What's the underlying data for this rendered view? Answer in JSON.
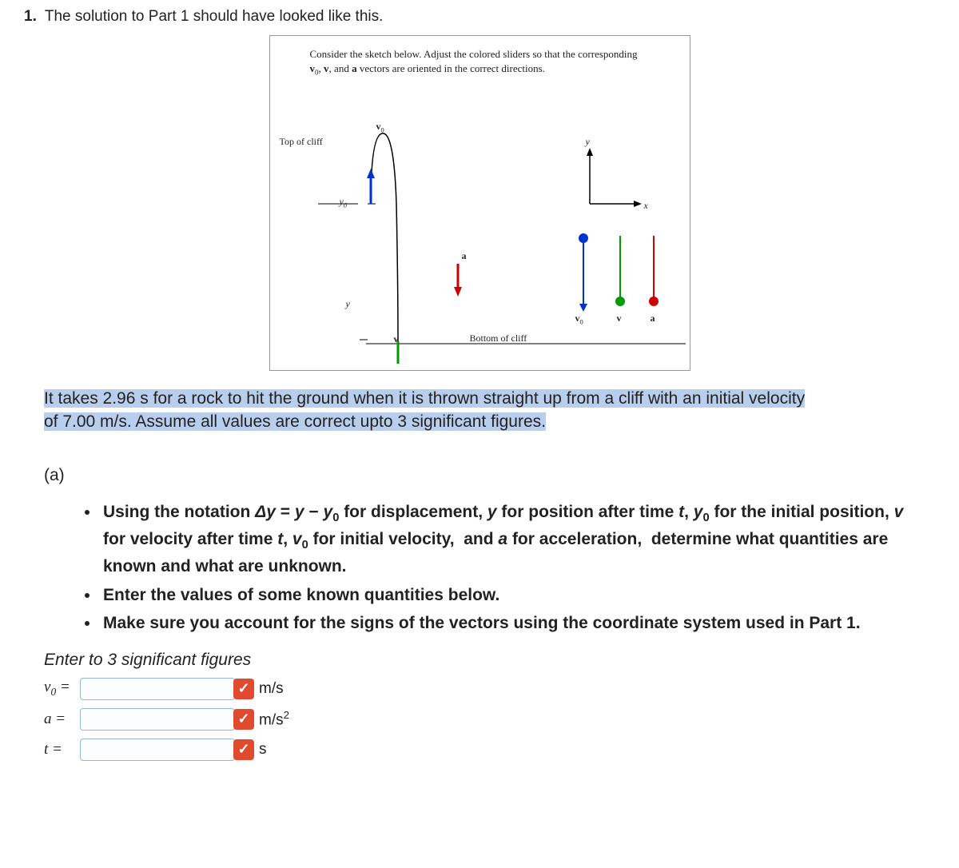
{
  "question_number": "1.",
  "intro_text": "The solution to Part 1 should have looked like this.",
  "diagram": {
    "instructions": "Consider the sketch below. Adjust the colored sliders so that the corresponding v₀, v, and a vectors are oriented in the correct directions.",
    "top_of_cliff": "Top of cliff",
    "bottom_of_cliff": "Bottom of cliff",
    "y0_label": "y₀",
    "y_label": "y",
    "v0_label": "v₀",
    "v_label": "v",
    "a_label": "a",
    "x_axis": "x",
    "y_axis": "y",
    "slider_v0": "v₀",
    "slider_v": "v",
    "slider_a": "a"
  },
  "highlighted_prompt": "It takes 2.96 s for a rock to hit the ground when it is thrown straight up from a cliff with an initial velocity of 7.00 m/s.  Assume all values are correct upto 3 significant figures.",
  "part_label": "(a)",
  "bullets": [
    "Using the notation Δy = y − y₀ for displacement, y for position after time t, y₀ for the initial position, v for velocity after time t, v₀ for initial velocity,  and a for acceleration,  determine what quantities are known and what are unknown.",
    "Enter the values of some known quantities below.",
    "Make sure you account for the signs of  the vectors using the coordinate system used in Part 1."
  ],
  "sigfig_instruction": "Enter to 3 significant figures",
  "inputs": {
    "v0": {
      "symbol_html": "v<sub>0</sub> =",
      "unit_html": "m/s"
    },
    "a": {
      "symbol_html": "a =",
      "unit_html": "m/s<sup>2</sup>"
    },
    "t": {
      "symbol_html": "t =",
      "unit_html": "s"
    }
  }
}
